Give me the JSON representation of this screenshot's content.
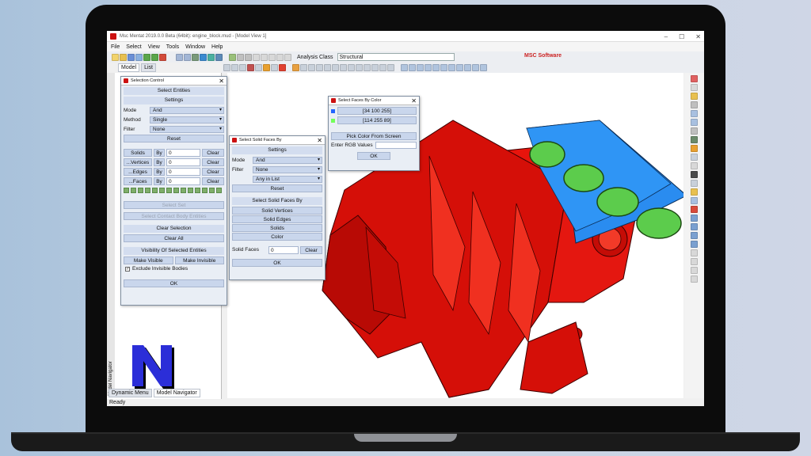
{
  "window": {
    "title": "Msc Mentat 2019.0.0 Beta (64bit): engine_block.mud - [Model View 1]",
    "minimize": "–",
    "maximize": "☐",
    "close": "✕"
  },
  "menu": [
    "File",
    "Select",
    "View",
    "Tools",
    "Window",
    "Help"
  ],
  "tabs": {
    "model": "Model",
    "list": "List"
  },
  "analysis_class": {
    "label": "Analysis Class",
    "value": "Structural"
  },
  "brand": "MSC Software",
  "selection_control": {
    "title": "Selection Control",
    "header": "Select Entities",
    "settings_label": "Settings",
    "mode_label": "Mode",
    "mode_value": "And",
    "method_label": "Method",
    "method_value": "Single",
    "filter_label": "Filter",
    "filter_value": "None",
    "reset": "Reset",
    "entities": [
      {
        "name": "Solids",
        "by": "By",
        "value": "0",
        "clear": "Clear"
      },
      {
        "name": "...Vertices",
        "by": "By",
        "value": "0",
        "clear": "Clear"
      },
      {
        "name": "...Edges",
        "by": "By",
        "value": "0",
        "clear": "Clear"
      },
      {
        "name": "...Faces",
        "by": "By",
        "value": "0",
        "clear": "Clear"
      }
    ],
    "select_set": "Select Set",
    "select_contact": "Select Contact Body Entities",
    "clear_selection_header": "Clear Selection",
    "clear_all": "Clear All",
    "visibility_header": "Visibility Of Selected Entities",
    "make_visible": "Make Visible",
    "make_invisible": "Make Invisible",
    "exclude_invisible": "Exclude Invisible Bodies",
    "ok": "OK"
  },
  "solid_faces": {
    "title": "Select Solid Faces By",
    "settings_label": "Settings",
    "mode_label": "Mode",
    "mode_value": "And",
    "filter_label": "Filter",
    "filter_value": "None",
    "list_value": "Any in List",
    "reset": "Reset",
    "header": "Select Solid Faces By",
    "options": [
      "Solid Vertices",
      "Solid Edges",
      "Solids",
      "Color"
    ],
    "count_label": "Solid Faces",
    "count_value": "0",
    "clear": "Clear",
    "ok": "OK"
  },
  "faces_by_color": {
    "title": "Select Faces By Color",
    "colors": [
      {
        "value": "[34 100 255]",
        "swatch": "#2264ff"
      },
      {
        "value": "[114 255 89]",
        "swatch": "#72ff59"
      }
    ],
    "pick": "Pick Color From Screen",
    "enter_rgb": "Enter RGB Values",
    "ok": "OK"
  },
  "left_tabs": {
    "dynamic_menu": "Dynamic Menu",
    "model_navigator": "Model Navigator"
  },
  "nav_vertical": "Model Navigator",
  "status": "Ready",
  "colors": {
    "solid_red": "#e8140c",
    "deck_blue": "#2a8cf0",
    "bore_green": "#5ccc4c"
  }
}
